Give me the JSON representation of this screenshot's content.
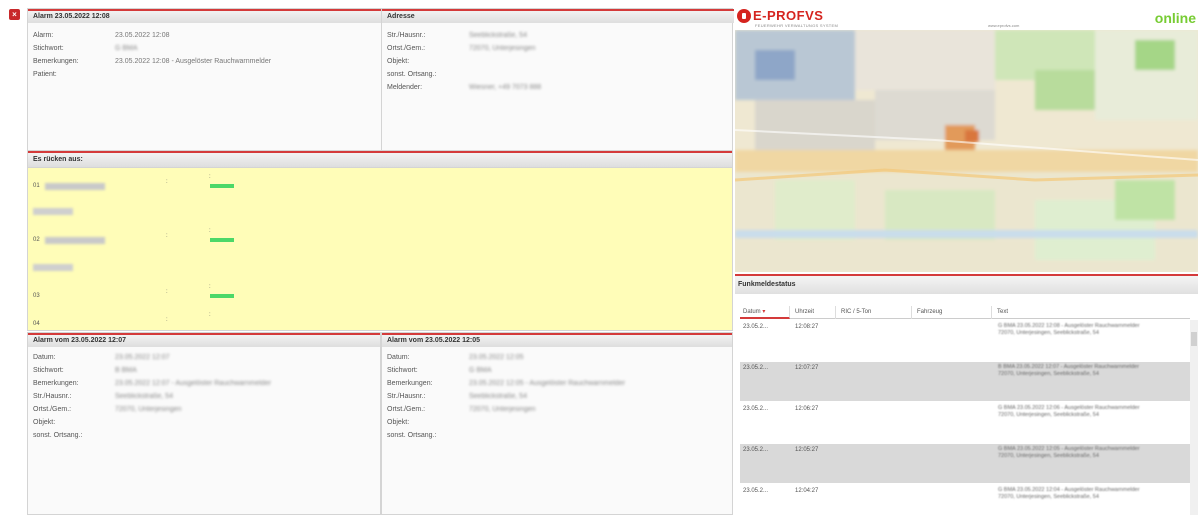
{
  "close_icon": "×",
  "alarm_top": {
    "title": "Alarm 23.05.2022 12:08",
    "rows": [
      {
        "label": "Alarm:",
        "value": "23.05.2022 12:08",
        "blurred": false
      },
      {
        "label": "Stichwort:",
        "value": "G BMA",
        "blurred": true
      },
      {
        "label": "Bemerkungen:",
        "value": "23.05.2022 12:08 - Ausgelöster Rauchwarnmelder",
        "blurred": false
      },
      {
        "label": "Patient:",
        "value": "",
        "blurred": false
      }
    ]
  },
  "address": {
    "title": "Adresse",
    "rows": [
      {
        "label": "Str./Hausnr.:",
        "value": "Seeblickstraße, 54",
        "blurred": true
      },
      {
        "label": "Ortst./Gem.:",
        "value": "72070, Unterjesingen",
        "blurred": true
      },
      {
        "label": "Objekt:",
        "value": "",
        "blurred": false
      },
      {
        "label": "sonst. Ortsang.:",
        "value": "",
        "blurred": false
      },
      {
        "label": "Meldender:",
        "value": "Wiesner, +49 7073 888",
        "blurred": true
      }
    ]
  },
  "dispatch": {
    "title": "Es rücken aus:",
    "units": [
      {
        "id": "01",
        "sub": "Tübingen"
      },
      {
        "id": "02",
        "sub": "Tübingen"
      },
      {
        "id": "03",
        "sub": ""
      },
      {
        "id": "04",
        "sub": ""
      }
    ],
    "separator": ":",
    "status_color": "#4cd868"
  },
  "alarm_left": {
    "title": "Alarm vom 23.05.2022 12:07",
    "rows": [
      {
        "label": "Datum:",
        "value": "23.05.2022 12:07",
        "blurred": true
      },
      {
        "label": "Stichwort:",
        "value": "B BMA",
        "blurred": true
      },
      {
        "label": "Bemerkungen:",
        "value": "23.05.2022 12:07 - Ausgelöster Rauchwarnmelder",
        "blurred": true
      },
      {
        "label": "Str./Hausnr.:",
        "value": "Seeblickstraße, 54",
        "blurred": true
      },
      {
        "label": "Ortst./Gem.:",
        "value": "72070, Unterjesingen",
        "blurred": true
      },
      {
        "label": "Objekt:",
        "value": "",
        "blurred": false
      },
      {
        "label": "sonst. Ortsang.:",
        "value": "",
        "blurred": false
      }
    ]
  },
  "alarm_right": {
    "title": "Alarm vom 23.05.2022 12:05",
    "rows": [
      {
        "label": "Datum:",
        "value": "23.05.2022 12:05",
        "blurred": true
      },
      {
        "label": "Stichwort:",
        "value": "G BMA",
        "blurred": true
      },
      {
        "label": "Bemerkungen:",
        "value": "23.05.2022 12:05 - Ausgelöster Rauchwarnmelder",
        "blurred": true
      },
      {
        "label": "Str./Hausnr.:",
        "value": "Seeblickstraße, 54",
        "blurred": true
      },
      {
        "label": "Ortst./Gem.:",
        "value": "72070, Unterjesingen",
        "blurred": true
      },
      {
        "label": "Objekt:",
        "value": "",
        "blurred": false
      },
      {
        "label": "sonst. Ortsang.:",
        "value": "",
        "blurred": false
      }
    ]
  },
  "brand": {
    "name": "E-PROFVS",
    "tagline": "FEUERWEHR VERWALTUNGS SYSTEM",
    "url": "www.eprofvs.com",
    "status": "online",
    "color": "#d5241f",
    "status_color": "#77cc33"
  },
  "funk": {
    "title": "Funkmeldestatus",
    "columns": [
      "Datum",
      "Uhrzeit",
      "RIC / 5-Ton",
      "Fahrzeug",
      "Text"
    ],
    "sort_icon": "▾",
    "rows": [
      {
        "date": "23.05.2...",
        "time": "12:08:27",
        "text": "G BMA 23.05.2022 12:08 - Ausgelöster Rauchwarnmelder 72070, Unterjesingen, Seeblickstraße, 54",
        "alt": false
      },
      {
        "date": "23.05.2...",
        "time": "12:07:27",
        "text": "B BMA 23.05.2022 12:07 - Ausgelöster Rauchwarnmelder 72070, Unterjesingen, Seeblickstraße, 54",
        "alt": true
      },
      {
        "date": "23.05.2...",
        "time": "12:06:27",
        "text": "G BMA 23.05.2022 12:06 - Ausgelöster Rauchwarnmelder 72070, Unterjesingen, Seeblickstraße, 54",
        "alt": false
      },
      {
        "date": "23.05.2...",
        "time": "12:05:27",
        "text": "G BMA 23.05.2022 12:05 - Ausgelöster Rauchwarnmelder 72070, Unterjesingen, Seeblickstraße, 54",
        "alt": true
      },
      {
        "date": "23.05.2...",
        "time": "12:04:27",
        "text": "G BMA 23.05.2022 12:04 - Ausgelöster Rauchwarnmelder 72070, Unterjesingen, Seeblickstraße, 54",
        "alt": false
      }
    ]
  }
}
